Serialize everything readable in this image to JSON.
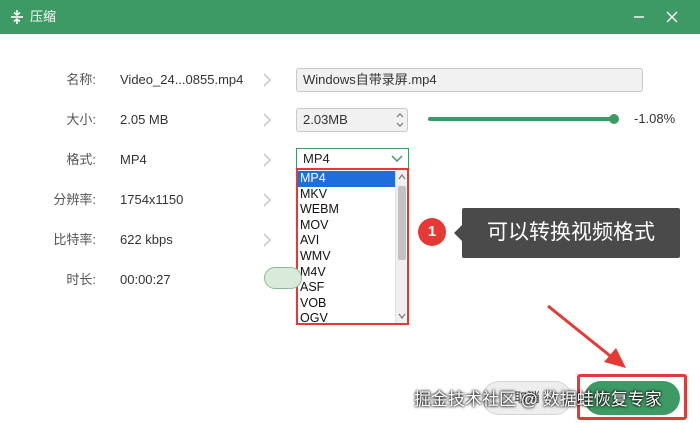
{
  "window": {
    "title": "压缩"
  },
  "fields": {
    "name": {
      "label": "名称:",
      "value": "Video_24...0855.mp4",
      "output": "Windows自带录屏.mp4"
    },
    "size": {
      "label": "大小:",
      "value": "2.05 MB",
      "output": "2.03MB",
      "percent": "-1.08%",
      "slider_level_percent": 99
    },
    "format": {
      "label": "格式:",
      "value": "MP4",
      "selected": "MP4",
      "options": [
        "MP4",
        "MKV",
        "WEBM",
        "MOV",
        "AVI",
        "WMV",
        "M4V",
        "ASF",
        "VOB",
        "OGV"
      ]
    },
    "resolution": {
      "label": "分辨率:",
      "value": "1754x1150"
    },
    "bitrate": {
      "label": "比特率:",
      "value": "622 kbps"
    },
    "duration": {
      "label": "时长:",
      "value": "00:00:27"
    }
  },
  "annotation": {
    "badge": "1",
    "tooltip": "可以转换视频格式"
  },
  "buttons": {
    "cancel": "取消"
  },
  "watermark": "掘金技术社区 @ 数据蛙恢复专家",
  "colors": {
    "brand": "#3e9a64",
    "highlight": "#e53935",
    "selection": "#1e6fd9"
  }
}
